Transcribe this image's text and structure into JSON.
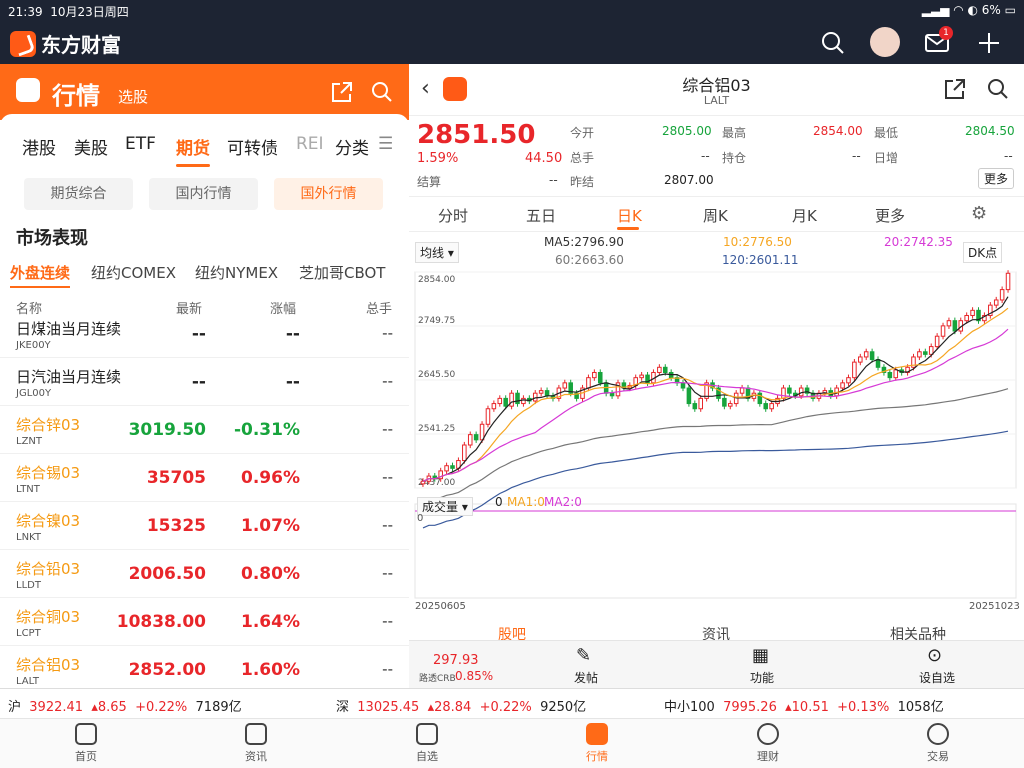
{
  "status": {
    "time": "21:39",
    "date": "10月23日周四",
    "battery": "6%"
  },
  "app": {
    "name": "东方财富",
    "mail_badge": "1"
  },
  "left": {
    "title": "行情",
    "subtitle": "选股",
    "tabs": [
      "港股",
      "美股",
      "ETF",
      "期货",
      "可转债",
      "REI",
      "分类"
    ],
    "active_tab": "期货",
    "segments": [
      "期货综合",
      "国内行情",
      "国外行情"
    ],
    "active_segment": "国外行情",
    "section_title": "市场表现",
    "subtabs": [
      "外盘连续",
      "纽约COMEX",
      "纽约NYMEX",
      "芝加哥CBOT"
    ],
    "columns": [
      "名称",
      "最新",
      "涨幅",
      "总手"
    ],
    "rows": [
      {
        "name": "日煤油当月连续",
        "code": "JKE00Y",
        "price": "--",
        "change": "--",
        "vol": "--",
        "color": "#222",
        "pcolor": "#222"
      },
      {
        "name": "日汽油当月连续",
        "code": "JGL00Y",
        "price": "--",
        "change": "--",
        "vol": "--",
        "color": "#222",
        "pcolor": "#222"
      },
      {
        "name": "综合锌03",
        "code": "LZNT",
        "price": "3019.50",
        "change": "-0.31%",
        "vol": "--",
        "color": "#f59a13",
        "pcolor": "#17a43c"
      },
      {
        "name": "综合锡03",
        "code": "LTNT",
        "price": "35705",
        "change": "0.96%",
        "vol": "--",
        "color": "#f59a13",
        "pcolor": "#e8262a"
      },
      {
        "name": "综合镍03",
        "code": "LNKT",
        "price": "15325",
        "change": "1.07%",
        "vol": "--",
        "color": "#f59a13",
        "pcolor": "#e8262a"
      },
      {
        "name": "综合铅03",
        "code": "LLDT",
        "price": "2006.50",
        "change": "0.80%",
        "vol": "--",
        "color": "#f59a13",
        "pcolor": "#e8262a"
      },
      {
        "name": "综合铜03",
        "code": "LCPT",
        "price": "10838.00",
        "change": "1.64%",
        "vol": "--",
        "color": "#f59a13",
        "pcolor": "#e8262a"
      },
      {
        "name": "综合铝03",
        "code": "LALT",
        "price": "2852.00",
        "change": "1.60%",
        "vol": "--",
        "color": "#f59a13",
        "pcolor": "#e8262a"
      }
    ]
  },
  "right": {
    "title": "综合铝03",
    "code": "LALT",
    "price": "2851.50",
    "pct": "1.59%",
    "chg": "44.50",
    "open_label": "今开",
    "open": "2805.00",
    "high_label": "最高",
    "high": "2854.00",
    "low_label": "最低",
    "low": "2804.50",
    "vol_label": "总手",
    "vol": "--",
    "oi_label": "持仓",
    "oi": "--",
    "daily_label": "日增",
    "daily": "--",
    "settle_label": "结算",
    "settle": "--",
    "prev_label": "昨结",
    "prev": "2807.00",
    "more": "更多",
    "period_tabs": [
      "分时",
      "五日",
      "日K",
      "周K",
      "月K",
      "更多"
    ],
    "active_period": "日K",
    "ma_select": "均线",
    "ma5": "MA5:2796.90",
    "ma10": "10:2776.50",
    "ma20": "20:2742.35",
    "ma60": "60:2663.60",
    "ma120": "120:2601.11",
    "dk": "DK点",
    "vol_select": "成交量",
    "vol_zero": "0",
    "ma1": "MA1:0",
    "ma2": "MA2:0",
    "vol_axis_zero": "0",
    "date_start": "20250605",
    "date_end": "20251023",
    "bottom_tabs": [
      "股吧",
      "资讯",
      "相关品种"
    ],
    "crb_value": "297.93",
    "crb_label": "路透CRB",
    "crb_pct": "0.85%",
    "actions": [
      "发帖",
      "功能",
      "设自选"
    ]
  },
  "indices": [
    {
      "name": "沪",
      "value": "3922.41",
      "chg": "8.65",
      "pct": "+0.22%",
      "amount": "7189亿"
    },
    {
      "name": "深",
      "value": "13025.45",
      "chg": "28.84",
      "pct": "+0.22%",
      "amount": "9250亿"
    },
    {
      "name": "中小100",
      "value": "7995.26",
      "chg": "10.51",
      "pct": "+0.13%",
      "amount": "1058亿"
    }
  ],
  "nav": [
    "首页",
    "资讯",
    "自选",
    "行情",
    "理财",
    "交易"
  ],
  "active_nav": "行情",
  "chart_data": {
    "type": "candlestick",
    "y_ticks": [
      "2854.00",
      "2749.75",
      "2645.50",
      "2541.25",
      "2437.00"
    ],
    "ylim": [
      2437.0,
      2854.0
    ],
    "x_range": [
      "20250605",
      "20251023"
    ],
    "close": [
      2450,
      2460,
      2455,
      2470,
      2480,
      2475,
      2490,
      2520,
      2540,
      2530,
      2560,
      2590,
      2600,
      2610,
      2595,
      2620,
      2600,
      2610,
      2605,
      2620,
      2625,
      2615,
      2610,
      2630,
      2640,
      2620,
      2610,
      2630,
      2650,
      2660,
      2640,
      2620,
      2615,
      2640,
      2630,
      2635,
      2650,
      2655,
      2640,
      2660,
      2670,
      2660,
      2650,
      2640,
      2630,
      2600,
      2590,
      2610,
      2640,
      2630,
      2610,
      2595,
      2600,
      2620,
      2630,
      2610,
      2620,
      2600,
      2590,
      2600,
      2610,
      2630,
      2620,
      2615,
      2630,
      2620,
      2610,
      2620,
      2625,
      2615,
      2630,
      2640,
      2650,
      2680,
      2690,
      2700,
      2685,
      2670,
      2660,
      2650,
      2665,
      2660,
      2670,
      2690,
      2700,
      2695,
      2710,
      2730,
      2750,
      2760,
      2740,
      2760,
      2770,
      2780,
      2760,
      2770,
      2790,
      2800,
      2820,
      2851.5
    ]
  }
}
